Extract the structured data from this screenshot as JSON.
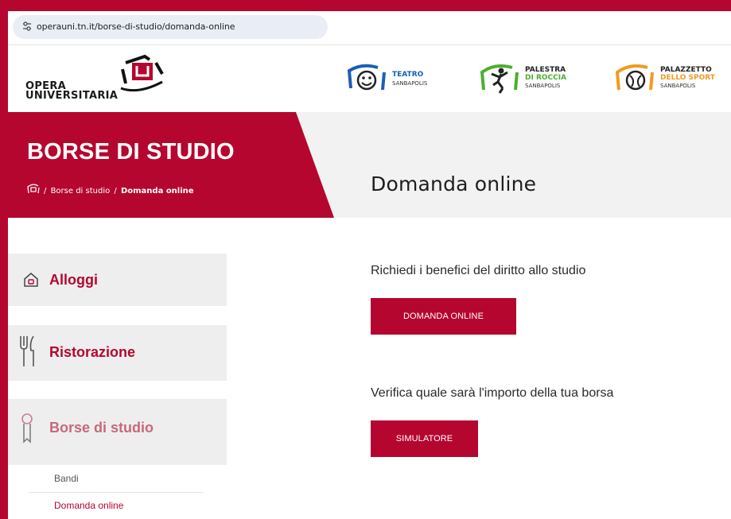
{
  "browser": {
    "url": "operauni.tn.it/borse-di-studio/domanda-online"
  },
  "header": {
    "logo_line1": "OPERA",
    "logo_line2": "UNIVERSITARIA",
    "partners": [
      {
        "name1": "TEATRO",
        "name2": "",
        "sub": "SANBAPOLIS",
        "accent": "#1a5fb4"
      },
      {
        "name1": "PALESTRA",
        "name2": "DI ROCCIA",
        "sub": "SANBAPOLIS",
        "accent": "#4caf2f"
      },
      {
        "name1": "PALAZZETTO",
        "name2": "DELLO SPORT",
        "sub": "SANBAPOLIS",
        "accent": "#f29a1e"
      }
    ]
  },
  "band": {
    "section_title": "BORSE DI STUDIO",
    "breadcrumb": {
      "sep": "/",
      "parent": "Borse di studio",
      "current": "Domanda online"
    },
    "page_title": "Domanda online"
  },
  "sidebar": {
    "items": [
      {
        "label": "Alloggi",
        "icon": "house-icon"
      },
      {
        "label": "Ristorazione",
        "icon": "fork-knife-icon"
      },
      {
        "label": "Borse di studio",
        "icon": "medal-icon"
      }
    ],
    "sub_items": [
      {
        "label": "Bandi"
      },
      {
        "label": "Domanda online"
      }
    ]
  },
  "main": {
    "prompt1": "Richiedi i benefici del diritto allo studio",
    "button1": "DOMANDA ONLINE",
    "prompt2": "Verifica quale sarà l'importo della tua borsa",
    "button2": "SIMULATORE"
  },
  "colors": {
    "brand_red": "#b5062f",
    "band_gray": "#f2f2f2",
    "sidebar_gray": "#eeeeee"
  }
}
